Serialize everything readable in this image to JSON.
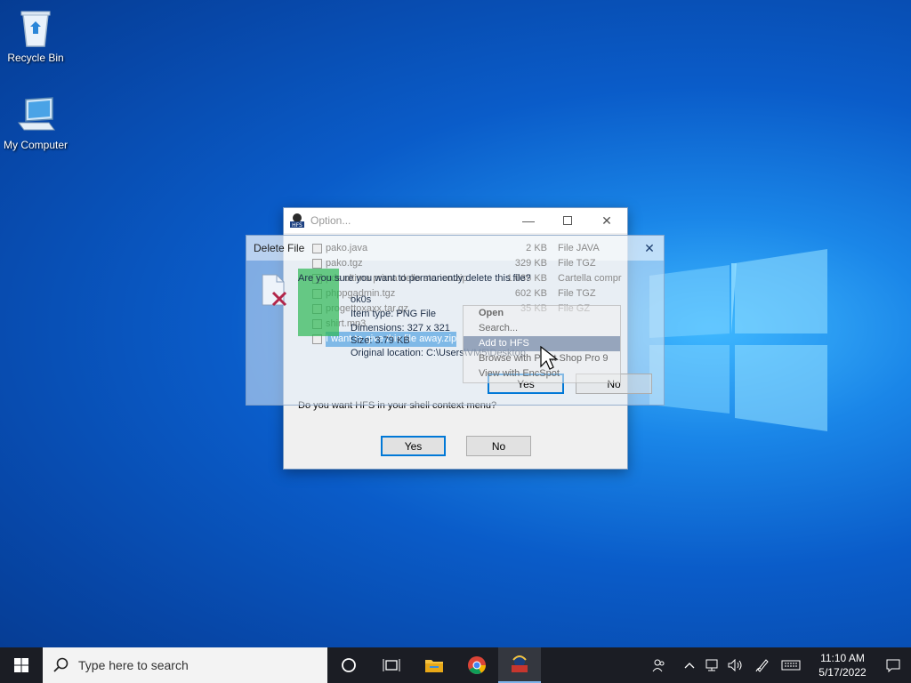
{
  "desktop": {
    "icons": [
      {
        "label": "Recycle Bin"
      },
      {
        "label": "My Computer"
      }
    ]
  },
  "options_window": {
    "title": "Option...",
    "question": "Do you want HFS in your shell context menu?",
    "yes_label": "Yes",
    "no_label": "No"
  },
  "delete_dialog": {
    "title": "Delete File",
    "question": "Are you sure you want to permanently delete this file?",
    "file_name": "ok0s",
    "item_type": "Item type: PNG File",
    "dimensions": "Dimensions: 327 x 321",
    "size": "Size: 3.79 KB",
    "location": "Original location: C:\\Users\\VM5\\Desktop",
    "yes_label": "Yes",
    "no_label": "No"
  },
  "file_list": [
    {
      "name": "pako.java",
      "size": "2 KB",
      "type": "File JAVA"
    },
    {
      "name": "pako.tgz",
      "size": "329 KB",
      "type": "File TGZ"
    },
    {
      "name": "pds ultima prima dello storico.zip",
      "size": "1.035 KB",
      "type": "Cartella compr"
    },
    {
      "name": "phppgadmin.tgz",
      "size": "602 KB",
      "type": "File TGZ"
    },
    {
      "name": "progettoxaxx.tar.gz",
      "size": "35 KB",
      "type": "File GZ"
    },
    {
      "name": "shirt.mp3",
      "size": "",
      "type": ""
    },
    {
      "name": "I want to give this file away.zip",
      "size": "",
      "type": ""
    }
  ],
  "context_menu": {
    "items": [
      {
        "label": "Open"
      },
      {
        "label": "Search..."
      },
      {
        "label": "Add to HFS"
      },
      {
        "label": "Browse with Paint Shop Pro 9"
      },
      {
        "label": "View with EncSpot"
      }
    ]
  },
  "taskbar": {
    "search_placeholder": "Type here to search",
    "time": "11:10 AM",
    "date": "5/17/2022"
  },
  "colors": {
    "accent": "#0078d7",
    "taskbar": "#1b1d24"
  }
}
